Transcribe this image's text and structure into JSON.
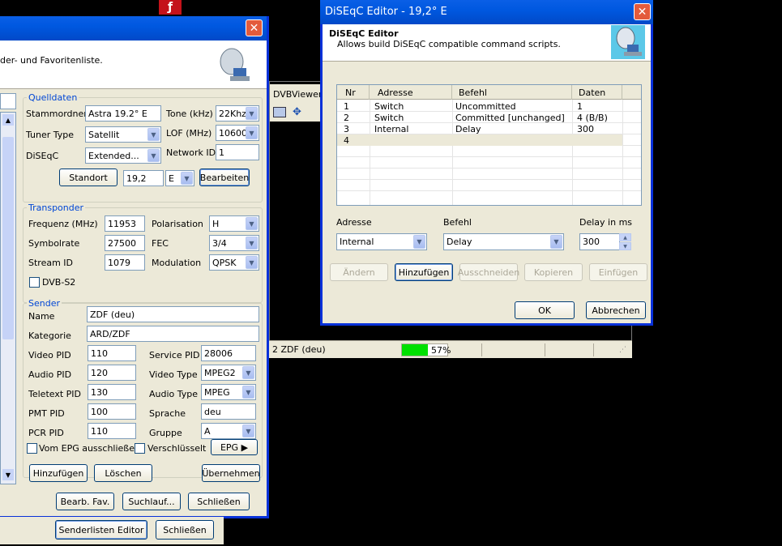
{
  "taskbar_icon": "flash-icon",
  "channel_editor": {
    "header_text": "der- und Favoritenliste.",
    "quelldaten": {
      "title": "Quelldaten",
      "stammordner_label": "Stammordner",
      "stammordner_value": "Astra 19.2° E",
      "tone_label": "Tone (kHz)",
      "tone_value": "22Khz",
      "tuner_type_label": "Tuner Type",
      "tuner_type_value": "Satellit",
      "lof_label": "LOF  (MHz)",
      "lof_value": "10600",
      "diseqc_label": "DiSEqC",
      "diseqc_value": "Extended...",
      "network_id_label": "Network ID",
      "network_id_value": "1",
      "standort_label": "Standort",
      "position_value": "19,2",
      "direction_value": "E",
      "bearbeiten_label": "Bearbeiten"
    },
    "transponder": {
      "title": "Transponder",
      "frequenz_label": "Frequenz (MHz)",
      "frequenz_value": "11953",
      "polarisation_label": "Polarisation",
      "polarisation_value": "H",
      "symbolrate_label": "Symbolrate",
      "symbolrate_value": "27500",
      "fec_label": "FEC",
      "fec_value": "3/4",
      "stream_id_label": "Stream ID",
      "stream_id_value": "1079",
      "modulation_label": "Modulation",
      "modulation_value": "QPSK",
      "dvbs2_label": "DVB-S2"
    },
    "sender": {
      "title": "Sender",
      "name_label": "Name",
      "name_value": "ZDF (deu)",
      "kategorie_label": "Kategorie",
      "kategorie_value": "ARD/ZDF",
      "video_pid_label": "Video PID",
      "video_pid_value": "110",
      "service_pid_label": "Service PID",
      "service_pid_value": "28006",
      "audio_pid_label": "Audio PID",
      "audio_pid_value": "120",
      "video_type_label": "Video Type",
      "video_type_value": "MPEG2",
      "teletext_pid_label": "Teletext PID",
      "teletext_pid_value": "130",
      "audio_type_label": "Audio Type",
      "audio_type_value": "MPEG",
      "pmt_pid_label": "PMT PID",
      "pmt_pid_value": "100",
      "sprache_label": "Sprache",
      "sprache_value": "deu",
      "pcr_pid_label": "PCR PID",
      "pcr_pid_value": "110",
      "gruppe_label": "Gruppe",
      "gruppe_value": "A",
      "epg_exclude_label": "Vom EPG ausschließen",
      "encrypted_label": "Verschlüsselt",
      "epg_button": "EPG"
    },
    "hinzufuegen_label": "Hinzufügen",
    "loeschen_label": "Löschen",
    "uebernehmen_label": "Übernehmen",
    "bearb_fav_label": "Bearb. Fav.",
    "suchlauf_label": "Suchlauf...",
    "schliessen_label": "Schließen"
  },
  "bottom_bar": {
    "senderlisten_label": "Senderlisten Editor",
    "schliessen_label": "Schließen"
  },
  "dvbviewer": {
    "menu_label": "DVBViewer",
    "status_channel": "2 ZDF (deu)",
    "signal_percent": 57,
    "signal_text": "57%",
    "signal_color": "#00e000"
  },
  "diseqc_editor": {
    "title": "DiSEqC Editor - 19,2° E",
    "header_title": "DiSEqC Editor",
    "header_subtitle": "Allows build DiSEqC compatible command scripts.",
    "columns": [
      "Nr",
      "Adresse",
      "Befehl",
      "Daten"
    ],
    "rows": [
      {
        "nr": "1",
        "adresse": "Switch",
        "befehl": "Uncommitted",
        "daten": "1"
      },
      {
        "nr": "2",
        "adresse": "Switch",
        "befehl": "Committed [unchanged]",
        "daten": "4  (B/B)"
      },
      {
        "nr": "3",
        "adresse": "Internal",
        "befehl": "Delay",
        "daten": "300"
      },
      {
        "nr": "4",
        "adresse": "",
        "befehl": "",
        "daten": ""
      }
    ],
    "adresse_label": "Adresse",
    "adresse_value": "Internal",
    "befehl_label": "Befehl",
    "befehl_value": "Delay",
    "delay_label": "Delay in ms",
    "delay_value": "300",
    "aendern_label": "Ändern",
    "hinzufuegen_label": "Hinzufügen",
    "ausschneiden_label": "Ausschneiden",
    "kopieren_label": "Kopieren",
    "einfuegen_label": "Einfügen",
    "ok_label": "OK",
    "abbrechen_label": "Abbrechen"
  }
}
